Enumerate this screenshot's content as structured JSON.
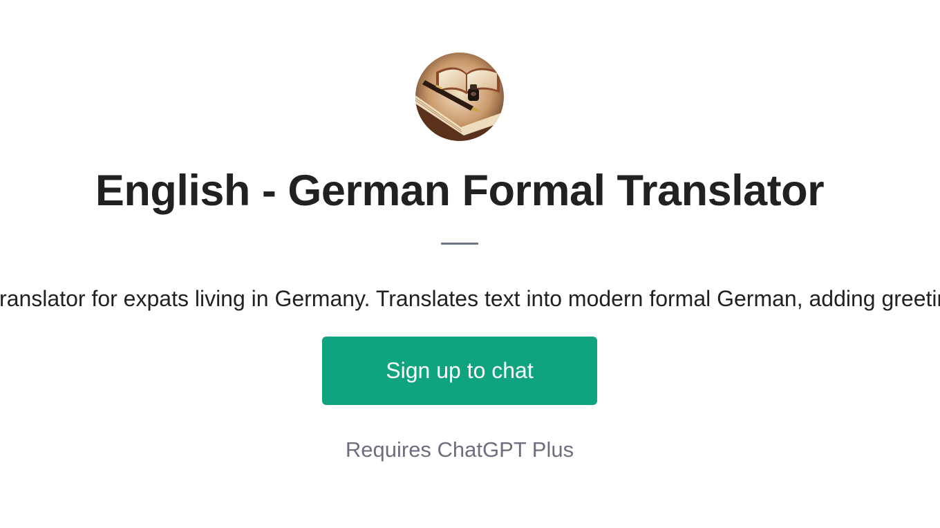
{
  "gpt": {
    "avatar_icon": "book-pen-inkwell-avatar",
    "title": "English - German Formal Translator",
    "description": "Formal German translator for expats living in Germany. Translates text into modern formal German, adding greetings and closings."
  },
  "actions": {
    "signup_label": "Sign up to chat"
  },
  "footer": {
    "requirement": "Requires ChatGPT Plus"
  },
  "colors": {
    "accent": "#10a37f",
    "title_text": "#202123",
    "muted_text": "#6e6e80",
    "divider": "#6b7280"
  }
}
